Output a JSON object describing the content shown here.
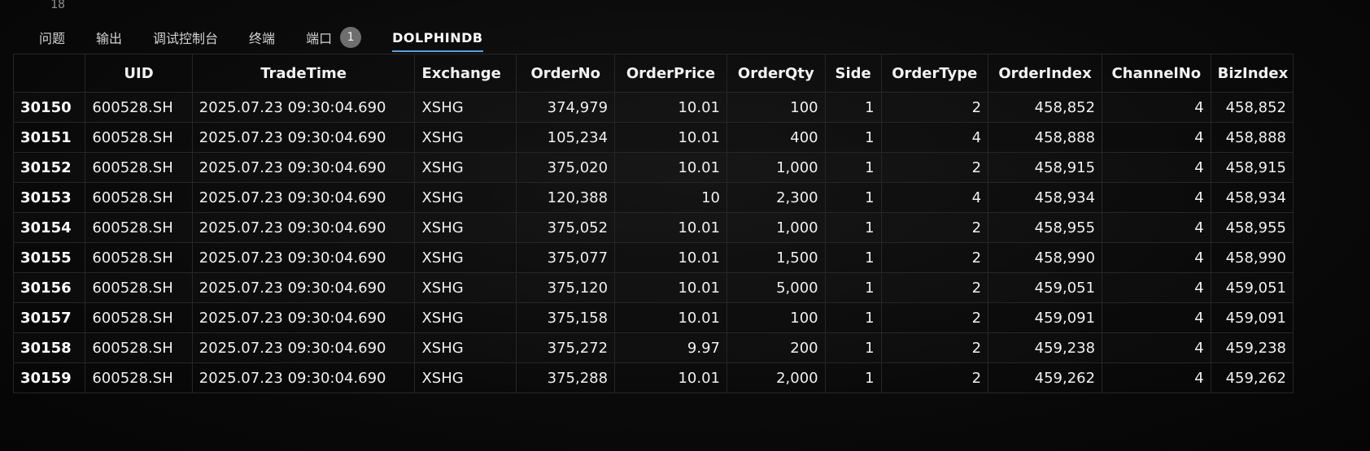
{
  "editor": {
    "line_number": "18"
  },
  "panel": {
    "tabs": [
      {
        "label": "问题"
      },
      {
        "label": "输出"
      },
      {
        "label": "调试控制台"
      },
      {
        "label": "终端"
      },
      {
        "label": "端口",
        "badge": "1"
      },
      {
        "label": "DOLPHINDB",
        "active": true
      }
    ]
  },
  "table": {
    "columns": [
      "UID",
      "TradeTime",
      "Exchange",
      "OrderNo",
      "OrderPrice",
      "OrderQty",
      "Side",
      "OrderType",
      "OrderIndex",
      "ChannelNo",
      "BizIndex"
    ],
    "rows": [
      {
        "index": "30150",
        "cells": [
          "600528.SH",
          "2025.07.23 09:30:04.690",
          "XSHG",
          "374,979",
          "10.01",
          "100",
          "1",
          "2",
          "458,852",
          "4",
          "458,852"
        ]
      },
      {
        "index": "30151",
        "cells": [
          "600528.SH",
          "2025.07.23 09:30:04.690",
          "XSHG",
          "105,234",
          "10.01",
          "400",
          "1",
          "4",
          "458,888",
          "4",
          "458,888"
        ]
      },
      {
        "index": "30152",
        "cells": [
          "600528.SH",
          "2025.07.23 09:30:04.690",
          "XSHG",
          "375,020",
          "10.01",
          "1,000",
          "1",
          "2",
          "458,915",
          "4",
          "458,915"
        ]
      },
      {
        "index": "30153",
        "cells": [
          "600528.SH",
          "2025.07.23 09:30:04.690",
          "XSHG",
          "120,388",
          "10",
          "2,300",
          "1",
          "4",
          "458,934",
          "4",
          "458,934"
        ]
      },
      {
        "index": "30154",
        "cells": [
          "600528.SH",
          "2025.07.23 09:30:04.690",
          "XSHG",
          "375,052",
          "10.01",
          "1,000",
          "1",
          "2",
          "458,955",
          "4",
          "458,955"
        ]
      },
      {
        "index": "30155",
        "cells": [
          "600528.SH",
          "2025.07.23 09:30:04.690",
          "XSHG",
          "375,077",
          "10.01",
          "1,500",
          "1",
          "2",
          "458,990",
          "4",
          "458,990"
        ]
      },
      {
        "index": "30156",
        "cells": [
          "600528.SH",
          "2025.07.23 09:30:04.690",
          "XSHG",
          "375,120",
          "10.01",
          "5,000",
          "1",
          "2",
          "459,051",
          "4",
          "459,051"
        ]
      },
      {
        "index": "30157",
        "cells": [
          "600528.SH",
          "2025.07.23 09:30:04.690",
          "XSHG",
          "375,158",
          "10.01",
          "100",
          "1",
          "2",
          "459,091",
          "4",
          "459,091"
        ]
      },
      {
        "index": "30158",
        "cells": [
          "600528.SH",
          "2025.07.23 09:30:04.690",
          "XSHG",
          "375,272",
          "9.97",
          "200",
          "1",
          "2",
          "459,238",
          "4",
          "459,238"
        ]
      },
      {
        "index": "30159",
        "cells": [
          "600528.SH",
          "2025.07.23 09:30:04.690",
          "XSHG",
          "375,288",
          "10.01",
          "2,000",
          "1",
          "2",
          "459,262",
          "4",
          "459,262"
        ]
      }
    ]
  }
}
